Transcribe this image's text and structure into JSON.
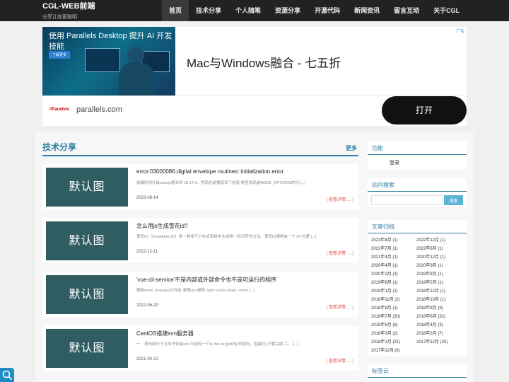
{
  "header": {
    "brand_title": "CGL-WEB前端",
    "brand_subtitle": "分享让你更聪明",
    "nav": [
      "首页",
      "技术分享",
      "个人随笔",
      "资源分享",
      "开源代码",
      "新闻资讯",
      "留言互动",
      "关于CGL"
    ]
  },
  "ad": {
    "image_title": "使用 Parallels Desktop 提升 AI 开发技能",
    "image_button": "了解更多",
    "headline": "Mac与Windows融合 - 七五折",
    "badge": "广告",
    "logo": "//Parallels",
    "domain": "parallels.com",
    "cta": "打开"
  },
  "main": {
    "section_title": "技术分享",
    "more_label": "更多",
    "posts": [
      {
        "thumb": "默认图",
        "title": "error:03000086:digital envelope routines::initialization error",
        "excerpt": "前端时间升级nodejs版本到 18.17.0，然后总是报错如下信息 排查发现是NODE_OPTIONS的问 [...]",
        "date": "2023-08-14",
        "more": "[ 查看详情 … ]"
      },
      {
        "thumb": "默认图",
        "title": "怎么用js生成雪花id?",
        "excerpt": "雪花ID（Snowflake ID）是一种用于分布式系统中生成唯一标识符的方法。雪花ID通常由一个 64 位整 [...]",
        "date": "2022-12-11",
        "more": "[ 查看详情 … ]"
      },
      {
        "thumb": "默认图",
        "title": "'vue-cli-service'不是内部或外部命令也不是可运行的程序",
        "excerpt": "删除node_modules文件夹 清理npm缓存 npm cache clean --force [...]",
        "date": "2022-06-20",
        "more": "[ 查看详情 … ]"
      },
      {
        "thumb": "默认图",
        "title": "CentOS搭建svn服务器",
        "excerpt": "一、首先执行下方命令安装svn 中途有一个is this ok [y/d/N] 的提问，直接打y下载完成 二、 [...]",
        "date": "2021-04-21",
        "more": "[ 查看详情 … ]"
      }
    ]
  },
  "sidebar": {
    "function_title": "功能",
    "login_label": "登录",
    "search_title": "站内搜索",
    "search_placeholder": "",
    "search_button": "搜索",
    "archive_title": "文章归档",
    "archives": [
      "2023年8月 (1)",
      "2022年12月 (1)",
      "2022年7月 (1)",
      "2022年6月 (1)",
      "2021年4月 (1)",
      "2020年12月 (1)",
      "2020年4月 (1)",
      "2020年3月 (1)",
      "2020年2月 (3)",
      "2019年8月 (1)",
      "2019年6月 (1)",
      "2019年2月 (1)",
      "2019年1月 (1)",
      "2018年12月 (1)",
      "2018年11月 (2)",
      "2018年10月 (1)",
      "2018年9月 (1)",
      "2018年8月 (9)",
      "2018年7月 (30)",
      "2018年6月 (32)",
      "2018年5月 (9)",
      "2018年4月 (3)",
      "2018年3月 (2)",
      "2018年2月 (7)",
      "2018年1月 (31)",
      "2017年12月 (25)",
      "2017年11月 (6)"
    ],
    "tags_title": "标签云"
  }
}
